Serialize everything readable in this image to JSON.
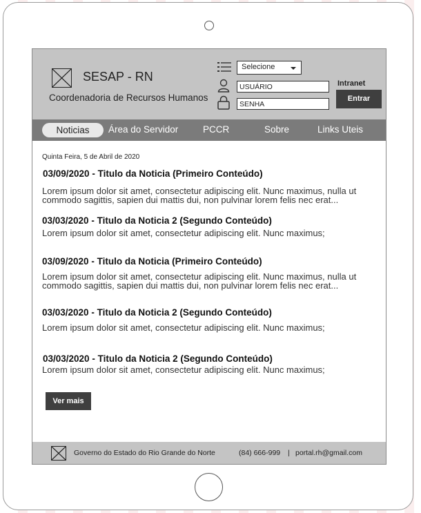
{
  "header": {
    "title": "SESAP - RN",
    "subtitle": "Coordenadoria de Recursos Humanos",
    "select_value": "Selecione",
    "user_field": "USUÁRIO",
    "password_field": "SENHA",
    "intranet_label": "Intranet",
    "login_label": "Entrar"
  },
  "nav": {
    "items": [
      "Noticias",
      "Área do Servidor",
      "PCCR",
      "Sobre",
      "Links Uteis"
    ]
  },
  "content": {
    "date": "Quinta Feira, 5 de Abril de 2020",
    "news": [
      {
        "date": "03/09/2020",
        "title": " - Titulo da Noticia (Primeiro Conteúdo)",
        "body": "Lorem ipsum dolor sit amet, consectetur adipiscing elit. Nunc maximus, nulla ut commodo sagittis, sapien dui mattis dui, non pulvinar lorem felis nec erat..."
      },
      {
        "date": "03/03/2020",
        "title": " - Titulo da Noticia 2 (Segundo Conteúdo)",
        "body": "Lorem ipsum dolor sit amet, consectetur adipiscing elit. Nunc maximus;"
      },
      {
        "date": "03/09/2020",
        "title": " - Titulo da Noticia (Primeiro Conteúdo)",
        "body": "Lorem ipsum dolor sit amet, consectetur adipiscing elit. Nunc maximus, nulla ut commodo sagittis, sapien dui mattis dui, non pulvinar lorem felis nec erat..."
      },
      {
        "date": "03/03/2020",
        "title": " - Titulo da Noticia 2 (Segundo Conteúdo)",
        "body": "Lorem ipsum dolor sit amet, consectetur adipiscing elit. Nunc maximus;"
      },
      {
        "date": "03/03/2020",
        "title": " - Titulo da Noticia 2 (Segundo Conteúdo)",
        "body": "Lorem ipsum dolor sit amet, consectetur adipiscing elit. Nunc maximus;"
      }
    ],
    "more_label": "Ver mais"
  },
  "footer": {
    "org": "Governo do Estado do Rio Grande do Norte",
    "phone": "(84) 666-999",
    "separator": "|",
    "email": "portal.rh@gmail.com"
  },
  "icons": {
    "logo": "image-placeholder-icon",
    "list": "list-icon",
    "user": "user-icon",
    "lock": "lock-icon"
  }
}
